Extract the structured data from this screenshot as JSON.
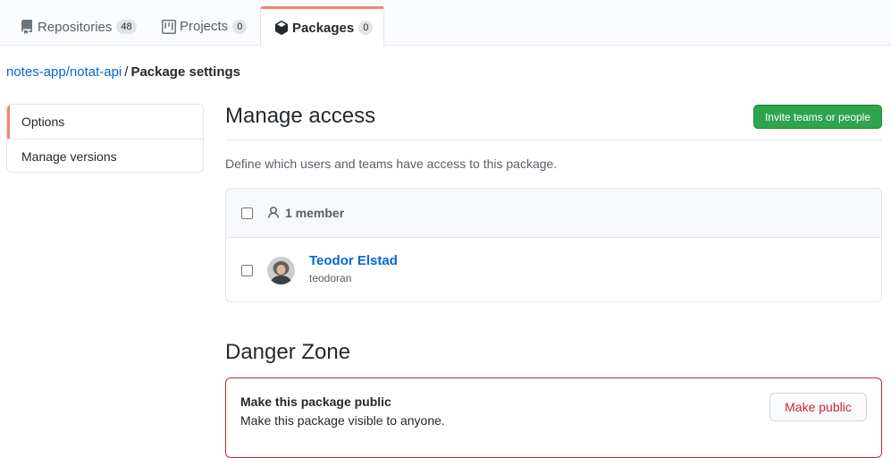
{
  "tabs": [
    {
      "label": "Repositories",
      "count": "48",
      "icon": "repo-icon"
    },
    {
      "label": "Projects",
      "count": "0",
      "icon": "project-icon"
    },
    {
      "label": "Packages",
      "count": "0",
      "icon": "package-icon",
      "selected": true
    }
  ],
  "breadcrumb": {
    "link": "notes-app/notat-api",
    "separator": "/",
    "current": "Package settings"
  },
  "side_menu": {
    "items": [
      {
        "label": "Options",
        "selected": true
      },
      {
        "label": "Manage versions",
        "selected": false
      }
    ]
  },
  "manage_access": {
    "title": "Manage access",
    "invite_button": "Invite teams or people",
    "description": "Define which users and teams have access to this package.",
    "member_count_label": "1 member",
    "members": [
      {
        "name": "Teodor Elstad",
        "login": "teodoran",
        "avatar": "avatar-photo"
      }
    ]
  },
  "danger_zone": {
    "title": "Danger Zone",
    "heading": "Make this package public",
    "text": "Make this package visible to anyone.",
    "button": "Make public"
  },
  "colors": {
    "accent_tab": "#f9826c",
    "link": "#0366d6",
    "primary_button": "#2ea44f",
    "danger": "#cb2431"
  }
}
